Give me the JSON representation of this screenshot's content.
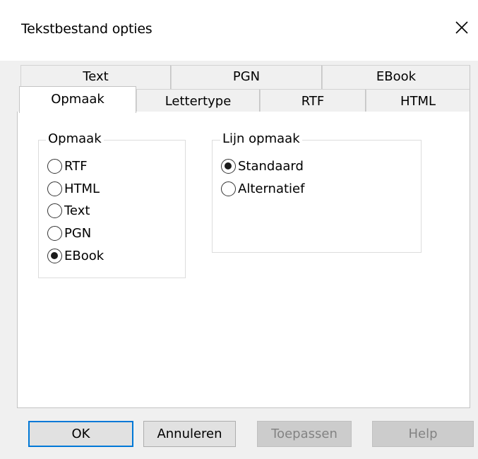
{
  "window": {
    "title": "Tekstbestand opties",
    "close_icon": "close-icon"
  },
  "tabs": {
    "back_row": [
      {
        "label": "Text"
      },
      {
        "label": "PGN"
      },
      {
        "label": "EBook"
      }
    ],
    "front_row": [
      {
        "label": "Opmaak",
        "selected": true
      },
      {
        "label": "Lettertype"
      },
      {
        "label": "RTF"
      },
      {
        "label": "HTML"
      }
    ]
  },
  "format_group": {
    "legend": "Opmaak",
    "options": [
      {
        "label": "RTF",
        "checked": false
      },
      {
        "label": "HTML",
        "checked": false
      },
      {
        "label": "Text",
        "checked": false
      },
      {
        "label": "PGN",
        "checked": false
      },
      {
        "label": "EBook",
        "checked": true
      }
    ]
  },
  "line_group": {
    "legend": "Lijn opmaak",
    "options": [
      {
        "label": "Standaard",
        "checked": true
      },
      {
        "label": "Alternatief",
        "checked": false
      }
    ]
  },
  "buttons": {
    "ok": "OK",
    "cancel": "Annuleren",
    "apply": "Toepassen",
    "help": "Help"
  },
  "colors": {
    "default_button_border": "#0078d7",
    "disabled_text": "#838383"
  }
}
